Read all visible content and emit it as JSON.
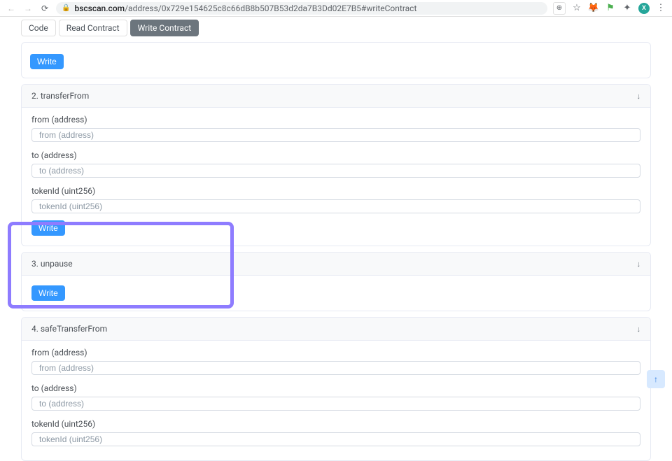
{
  "browser": {
    "url_host": "bscscan.com",
    "url_path": "/address/0x729e154625c8c66dB8b507B53d2da7B3Dd02E7B5#writeContract",
    "avatar_letter": "X"
  },
  "tabs": {
    "code": "Code",
    "read": "Read Contract",
    "write": "Write Contract"
  },
  "buttons": {
    "write": "Write"
  },
  "sections": {
    "transferFrom": {
      "title": "2. transferFrom",
      "fields": {
        "from_label": "from (address)",
        "from_placeholder": "from (address)",
        "to_label": "to (address)",
        "to_placeholder": "to (address)",
        "tokenId_label": "tokenId (uint256)",
        "tokenId_placeholder": "tokenId (uint256)"
      }
    },
    "unpause": {
      "title": "3. unpause"
    },
    "safeTransferFrom": {
      "title": "4. safeTransferFrom",
      "fields": {
        "from_label": "from (address)",
        "from_placeholder": "from (address)",
        "to_label": "to (address)",
        "to_placeholder": "to (address)",
        "tokenId_label": "tokenId (uint256)",
        "tokenId_placeholder": "tokenId (uint256)"
      }
    }
  }
}
